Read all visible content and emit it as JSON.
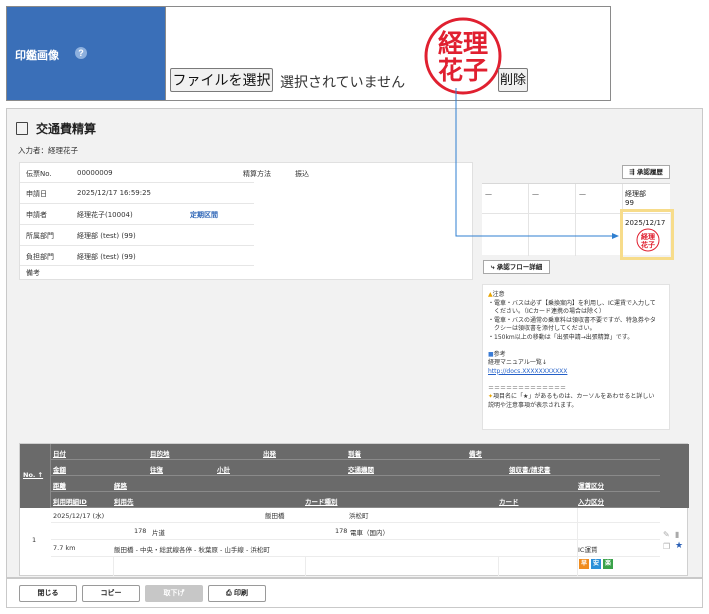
{
  "seal_panel": {
    "label": "印鑑画像",
    "help_icon": "?",
    "file_select_label": "ファイルを選択",
    "file_status": "選択されていません",
    "delete_label": "削除",
    "seal_text": [
      "経理",
      "花子"
    ],
    "seal_color": "#e02030"
  },
  "page": {
    "title": "交通費精算",
    "entered_by": "入力者：経理花子"
  },
  "info": {
    "rows": [
      {
        "key": "伝票No.",
        "value": "00000009"
      },
      {
        "key": "申請日",
        "value": "2025/12/17 16:59:25"
      },
      {
        "key": "申請者",
        "value": "経理花子(10004)"
      },
      {
        "key": "所属部門",
        "value": "経理部 (test) (99)"
      },
      {
        "key": "負担部門",
        "value": "経理部 (test) (99)"
      },
      {
        "key": "備考",
        "value": ""
      }
    ],
    "period_link": "定期区間",
    "settlement_key": "精算方法",
    "settlement_value": "振込"
  },
  "approval": {
    "history_button": "承認履歴",
    "dashes": [
      "—",
      "—",
      "—"
    ],
    "dept": "経理部",
    "dept_code": "99",
    "date": "2025/12/17",
    "flow_button": "承認フロー詳細"
  },
  "notes": {
    "caution_title": "注意",
    "caution_lines": [
      "・電車・バスは必ず【乗換案内】を利用し、IC運賃で入力して",
      "　ください。（ICカード連携の場合は除く）",
      "・電車・バスの通常の乗車料は領収書不要ですが、特急券やタ",
      "　クシーは領収書を添付してください。",
      "・150km以上の移動は「出張申請→出張精算」です。"
    ],
    "ref_title": "参考",
    "ref_line": "経理マニュアル一覧↓",
    "ref_link": "http://docs.XXXXXXXXXXX",
    "separator": "＝＝＝＝＝＝＝＝＝＝＝＝＝",
    "star_line1": "項目名に「★」があるものは、カーソルをあわせると詳しい",
    "star_line2": "説明や注意事項が表示されます。"
  },
  "table": {
    "no_header": "No. ↑",
    "header_row1": [
      "日付",
      "目的地",
      "出発",
      "到着",
      "備考"
    ],
    "header_row2": [
      "金額",
      "往復",
      "小計",
      "交通機関",
      "領収書/請求書"
    ],
    "header_row3": [
      "距離",
      "経路",
      "運賃区分"
    ],
    "header_row4": [
      "利用明細ID",
      "利用先",
      "カード種別",
      "カード",
      "入力区分"
    ],
    "row": {
      "no": "1",
      "date": "2025/12/17 (水)",
      "from": "飯田橋",
      "to": "浜松町",
      "amount": "178",
      "round_trip": "片道",
      "subtotal": "178",
      "transport": "電車（国内）",
      "distance": "7.7 km",
      "route": "飯田橋 - 中央・総武線各停 - 秋葉原 - 山手線 - 浜松町",
      "fare_type": "IC運賃",
      "tags": [
        "早",
        "安",
        "楽"
      ]
    }
  },
  "toolbar": {
    "close": "閉じる",
    "copy": "コピー",
    "withdraw": "取下げ",
    "print": "印刷"
  },
  "colors": {
    "panel_blue": "#3a6fb8",
    "connector": "#2f7fd0",
    "highlight": "#f7dc8a",
    "header_gray": "#6a6a6a"
  }
}
